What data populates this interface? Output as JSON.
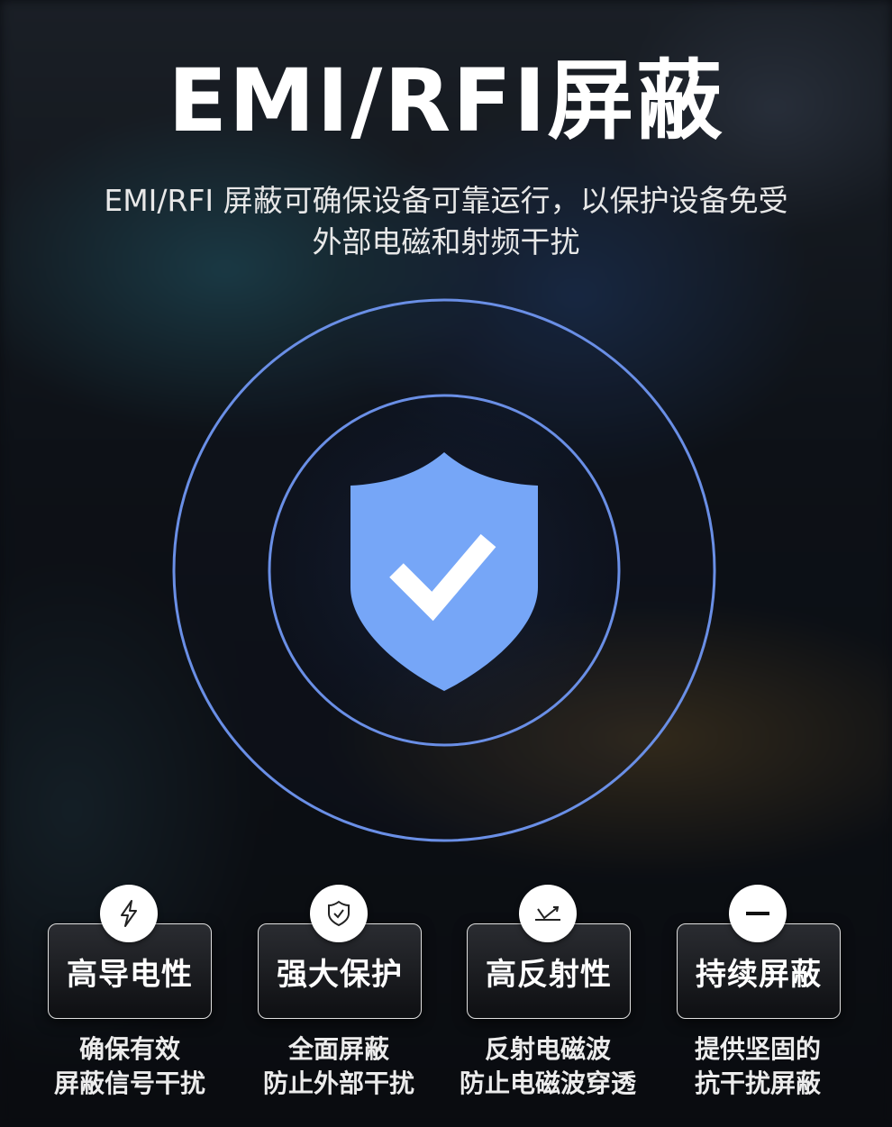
{
  "header": {
    "title": "EMI/RFI屏蔽",
    "subtitle_line1": "EMI/RFI 屏蔽可确保设备可靠运行，以保护设备免受",
    "subtitle_line2": "外部电磁和射频干扰"
  },
  "colors": {
    "accent": "#6f9ef5",
    "ring": "#6a8fe6",
    "shield": "#76a6f7"
  },
  "features": [
    {
      "icon": "lightning-icon",
      "label": "高导电性",
      "desc_line1": "确保有效",
      "desc_line2": "屏蔽信号干扰"
    },
    {
      "icon": "shield-check-icon",
      "label": "强大保护",
      "desc_line1": "全面屏蔽",
      "desc_line2": "防止外部干扰"
    },
    {
      "icon": "reflect-arrow-icon",
      "label": "高反射性",
      "desc_line1": "反射电磁波",
      "desc_line2": "防止电磁波穿透"
    },
    {
      "icon": "minus-icon",
      "label": "持续屏蔽",
      "desc_line1": "提供坚固的",
      "desc_line2": "抗干扰屏蔽"
    }
  ]
}
